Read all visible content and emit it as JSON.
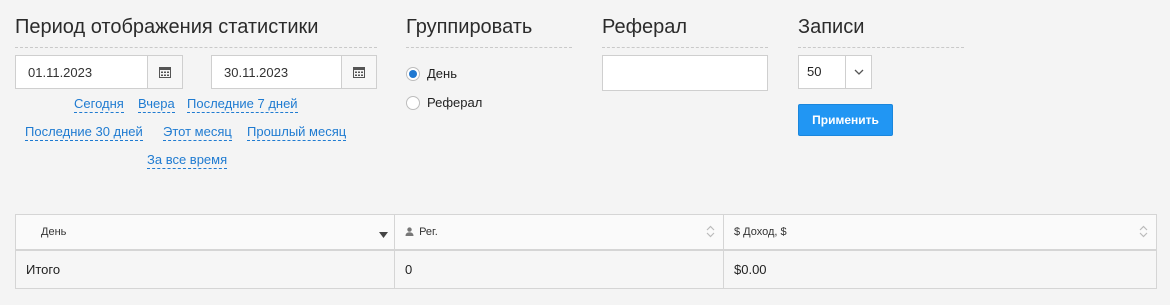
{
  "period": {
    "title": "Период отображения статистики",
    "date_from": "01.11.2023",
    "date_to": "30.11.2023",
    "quick_links": [
      "Сегодня",
      "Вчера",
      "Последние 7 дней",
      "Последние 30 дней",
      "Этот месяц",
      "Прошлый месяц",
      "За все время"
    ]
  },
  "group": {
    "title": "Группировать",
    "options": [
      {
        "label": "День",
        "selected": true
      },
      {
        "label": "Реферал",
        "selected": false
      }
    ]
  },
  "referral": {
    "title": "Реферал",
    "value": ""
  },
  "records": {
    "title": "Записи",
    "value": "50",
    "apply_label": "Применить"
  },
  "table": {
    "columns": [
      {
        "label": "День",
        "icon": "caret-down-icon"
      },
      {
        "label": "Рег.",
        "icon": "user-icon"
      },
      {
        "label": "$ Доход, $",
        "icon": "sort-icon"
      }
    ],
    "rows": [
      [
        "Итого",
        "0",
        "$0.00"
      ]
    ]
  },
  "colors": {
    "accent": "#2196f3",
    "link": "#1f7bd1",
    "background": "#f4f4f4"
  }
}
